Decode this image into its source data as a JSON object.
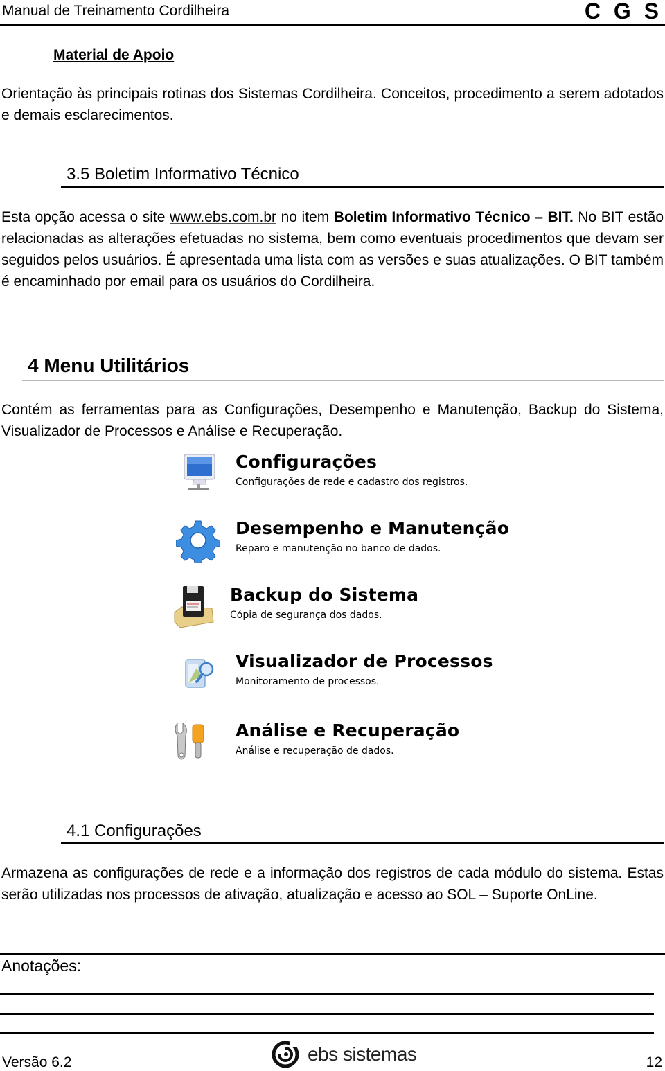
{
  "header": {
    "title": "Manual de Treinamento Cordilheira",
    "brand": "C G S"
  },
  "material_apoio": {
    "heading": "Material de Apoio",
    "text": "Orientação às principais rotinas dos Sistemas Cordilheira. Conceitos, procedimento a serem adotados e demais esclarecimentos."
  },
  "section_3_5": {
    "heading": "3.5 Boletim Informativo Técnico",
    "intro_before_link": "Esta opção acessa o site ",
    "link_text": "www.ebs.com.br",
    "intro_after_link": " no item ",
    "bold_text": "Boletim Informativo Técnico – BIT.",
    "rest": " No BIT estão relacionadas as alterações efetuadas no sistema, bem como eventuais procedimentos que devam ser seguidos pelos usuários. É apresentada uma lista com as versões e suas atualizações. O BIT também é encaminhado por email para os usuários do Cordilheira."
  },
  "section_4": {
    "heading": "4 Menu Utilitários",
    "text": "Contém as ferramentas para as Configurações, Desempenho e Manutenção, Backup do Sistema, Visualizador de Processos e Análise e Recuperação.",
    "menu_items": [
      {
        "icon": "monitor-icon",
        "title": "Configurações",
        "description": "Configurações de rede e cadastro dos registros."
      },
      {
        "icon": "gear-icon",
        "title": "Desempenho e Manutenção",
        "description": "Reparo e manutenção no banco de dados."
      },
      {
        "icon": "floppy-disk-icon",
        "title": "Backup do Sistema",
        "description": "Cópia de segurança dos dados."
      },
      {
        "icon": "process-viewer-icon",
        "title": "Visualizador de Processos",
        "description": "Monitoramento de processos."
      },
      {
        "icon": "tools-icon",
        "title": "Análise e Recuperação",
        "description": "Análise e recuperação de dados."
      }
    ]
  },
  "section_4_1": {
    "heading": "4.1 Configurações",
    "text": "Armazena as configurações de rede e a informação dos registros de cada módulo do sistema. Estas serão utilizadas nos processos de ativação, atualização e acesso ao SOL – Suporte OnLine."
  },
  "notes": {
    "label": "Anotações:"
  },
  "footer": {
    "version": "Versão 6.2",
    "logo_text": "ebs sistemas",
    "page_number": "12"
  }
}
